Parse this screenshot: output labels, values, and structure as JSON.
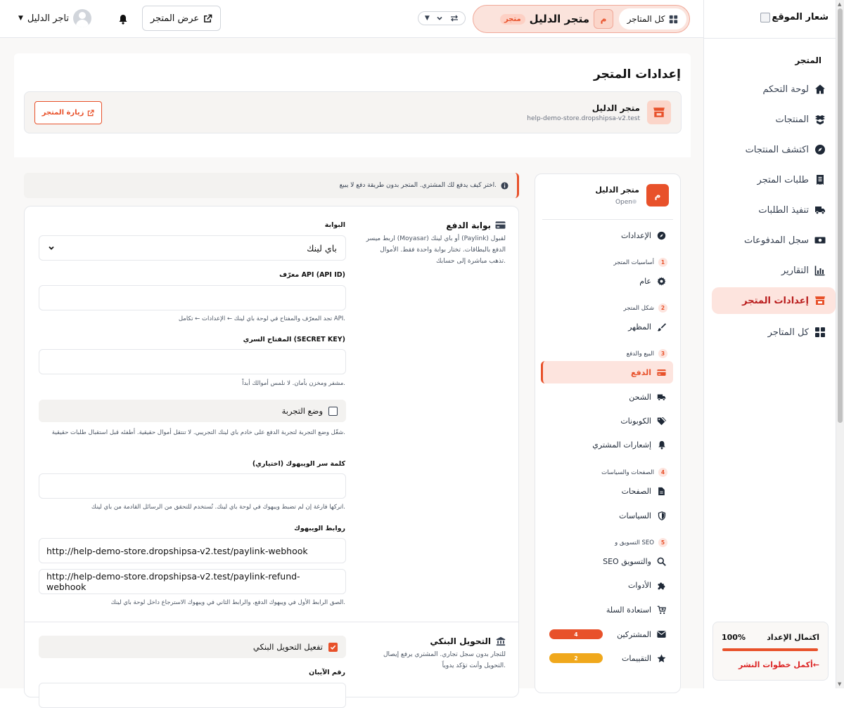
{
  "sidebar": {
    "logo_text": "شعار الموقع",
    "section_label": "المتجر",
    "items": [
      {
        "label": "لوحة التحكم",
        "icon": "home-icon"
      },
      {
        "label": "المنتجات",
        "icon": "boxes-icon"
      },
      {
        "label": "اكتشف المنتجات",
        "icon": "compass-icon"
      },
      {
        "label": "طلبات المتجر",
        "icon": "receipt-icon"
      },
      {
        "label": "تنفيذ الطلبات",
        "icon": "truck-fast-icon"
      },
      {
        "label": "سجل المدفوعات",
        "icon": "money-icon"
      },
      {
        "label": "التقارير",
        "icon": "chart-icon"
      },
      {
        "label": "إعدادات المتجر",
        "icon": "store-icon"
      },
      {
        "label": "كل المتاجر",
        "icon": "grid-icon"
      }
    ],
    "setup": {
      "title": "اكتمال الإعداد",
      "percent_label": "100%",
      "progress": 1.0,
      "link": "أكمل خطوات النشر←"
    }
  },
  "topbar": {
    "all_stores": "كل المتاجر",
    "current_store_initial": "م",
    "current_store_name": "متجر الدليل",
    "current_store_badge": "متجر",
    "view_store": "عرض المتجر",
    "user_name": "تاجر الدليل"
  },
  "page": {
    "title": "إعدادات المتجر",
    "store_name": "متجر الدليل",
    "store_domain": "help-demo-store.dropshipsa-v2.test",
    "visit_button": "زيارة المتجر"
  },
  "settings_nav": {
    "store_initial": "م",
    "store_name": "متجر الدليل",
    "status": "Open",
    "items": {
      "settings": "الإعدادات",
      "g1_num": "1",
      "g1": "أساسيات المتجر",
      "general": "عام",
      "g2_num": "2",
      "g2": "شكل المتجر",
      "appearance": "المظهر",
      "g3_num": "3",
      "g3": "البيع والدفع",
      "payment": "الدفع",
      "shipping": "الشحن",
      "coupons": "الكوبونات",
      "notifications": "إشعارات المشتري",
      "g4_num": "4",
      "g4": "الصفحات والسياسات",
      "pages": "الصفحات",
      "policies": "السياسات",
      "g5_num": "5",
      "g5": "التسويق و SEO",
      "seo": "SEO والتسويق",
      "tools": "الأدوات",
      "cart_recovery": "استعادة السلة",
      "subscribers": "المشتركين",
      "subscribers_count": "4",
      "reviews": "التقييمات",
      "reviews_count": "2"
    }
  },
  "info_banner": "اختر كيف يدفع لك المشتري. المتجر بدون طريقة دفع لا يبيع.",
  "gateway": {
    "title": "بوابة الدفع",
    "desc": "اربط ميسر (Moyasar) أو باي لينك (Paylink) لقبول الدفع بالبطاقات. تختار بوابة واحدة فقط. الأموال تذهب مباشرة إلى حسابك.",
    "gateway_label": "البوابة",
    "gateway_value": "باي لينك",
    "api_id_label": "معرّف API (API ID)",
    "api_id_value": "",
    "api_id_help": "تجد المعرّف والمفتاح في لوحة باي لينك ← الإعدادات ← تكامل API.",
    "secret_label": "المفتاح السري (SECRET KEY)",
    "secret_value": "",
    "secret_help": "مشفر ومخزن بأمان. لا نلمس أموالك أبداً.",
    "test_mode_label": "وضع التجربة",
    "test_mode_checked": false,
    "test_mode_help": "شغّل وضع التجربة لتجربة الدفع على خادم باي لينك التجريبي. لا تنتقل أموال حقيقية. أطفئه قبل استقبال طلبات حقيقية.",
    "webhook_pw_label": "كلمة سر الويبهوك (اختياري)",
    "webhook_pw_value": "",
    "webhook_pw_help": "اتركها فارغة إن لم تضبط ويبهوك في لوحة باي لينك. تُستخدم للتحقق من الرسائل القادمة من باي لينك.",
    "webhook_links_label": "روابط الويبهوك",
    "webhook_url_1": "http://help-demo-store.dropshipsa-v2.test/paylink-webhook",
    "webhook_url_2": "http://help-demo-store.dropshipsa-v2.test/paylink-refund-webhook",
    "webhook_links_help": "الصق الرابط الأول في ويبهوك الدفع، والرابط الثاني في ويبهوك الاسترجاع داخل لوحة باي لينك."
  },
  "bank": {
    "title": "التحويل البنكي",
    "desc": "للتجار بدون سجل تجاري. المشتري يرفع إيصال التحويل وأنت تؤكد يدوياً.",
    "enable_label": "تفعيل التحويل البنكي",
    "enable_checked": true,
    "iban_label": "رقم الآيبان"
  },
  "colors": {
    "accent": "#e8512a",
    "accent_soft": "#fde4de",
    "reviews_pill": "#f0a81c",
    "subscribers_pill": "#e8512a"
  }
}
